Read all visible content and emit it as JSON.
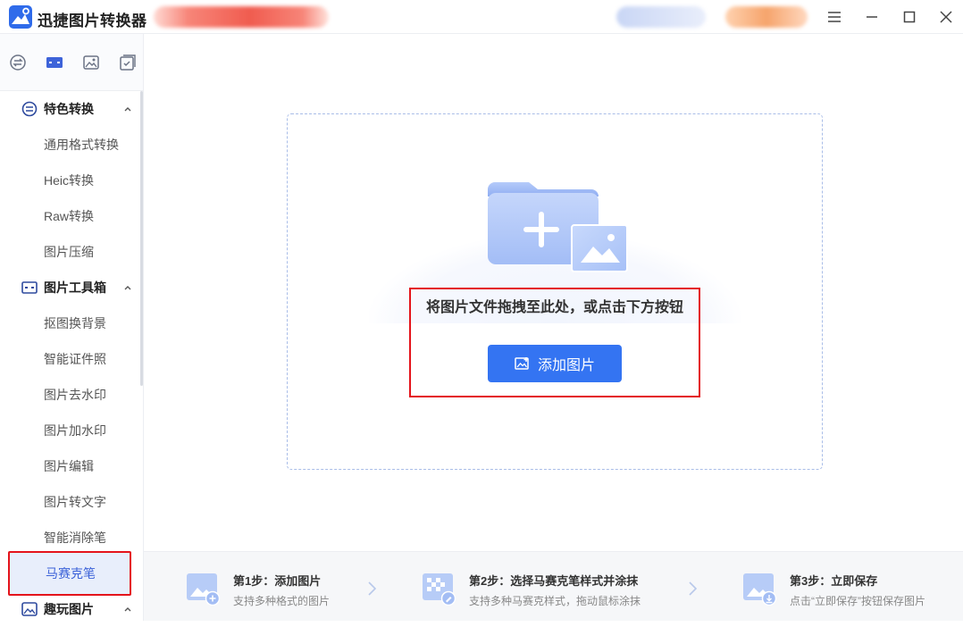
{
  "app": {
    "title": "迅捷图片转换器"
  },
  "sidebar": {
    "sections": [
      {
        "label": "特色转换",
        "items": [
          "通用格式转换",
          "Heic转换",
          "Raw转换",
          "图片压缩"
        ]
      },
      {
        "label": "图片工具箱",
        "items": [
          "抠图换背景",
          "智能证件照",
          "图片去水印",
          "图片加水印",
          "图片编辑",
          "图片转文字",
          "智能消除笔",
          "马赛克笔"
        ]
      },
      {
        "label": "趣玩图片",
        "items": []
      }
    ],
    "active_item": "马赛克笔"
  },
  "main": {
    "drop_text": "将图片文件拖拽至此处，或点击下方按钮",
    "add_button_label": "添加图片"
  },
  "steps": [
    {
      "title": "第1步：添加图片",
      "desc": "支持多种格式的图片"
    },
    {
      "title": "第2步：选择马赛克笔样式并涂抹",
      "desc": "支持多种马赛克样式，拖动鼠标涂抹"
    },
    {
      "title": "第3步：立即保存",
      "desc": "点击“立即保存”按钮保存图片"
    }
  ],
  "colors": {
    "accent": "#3474f2",
    "highlight_border": "#e4141b",
    "active_item_bg": "#e8eefb"
  }
}
